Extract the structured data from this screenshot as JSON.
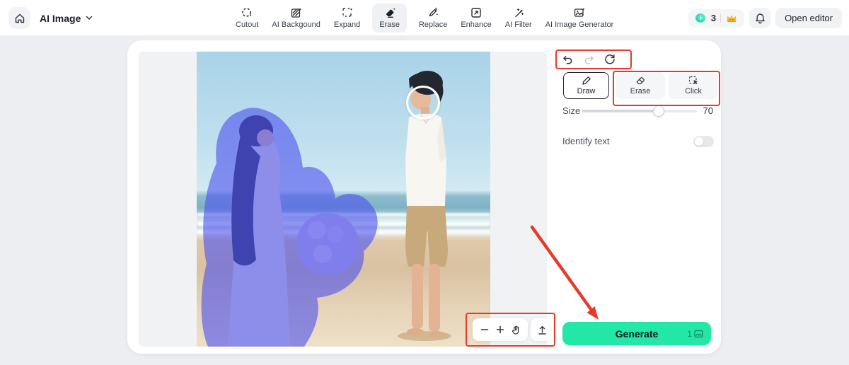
{
  "topbar": {
    "brand_label": "AI Image",
    "tools": [
      {
        "label": "Cutout",
        "icon": "cutout-icon",
        "selected": false
      },
      {
        "label": "AI Backgound",
        "icon": "ai-background-icon",
        "selected": false
      },
      {
        "label": "Expand",
        "icon": "expand-icon",
        "selected": false
      },
      {
        "label": "Erase",
        "icon": "erase-icon",
        "selected": true
      },
      {
        "label": "Replace",
        "icon": "replace-icon",
        "selected": false
      },
      {
        "label": "Enhance",
        "icon": "enhance-icon",
        "selected": false
      },
      {
        "label": "AI Filter",
        "icon": "ai-filter-icon",
        "selected": false
      },
      {
        "label": "AI Image Generator",
        "icon": "ai-image-generator-icon",
        "selected": false
      }
    ],
    "credits": {
      "count": "3",
      "coin_icon": "coin-icon",
      "crown_icon": "crown-icon"
    },
    "bell_icon": "bell-icon",
    "open_editor_label": "Open editor"
  },
  "panel": {
    "history": {
      "undo_icon": "undo-icon",
      "redo_icon": "redo-icon",
      "reset_icon": "reset-icon"
    },
    "modes": [
      {
        "label": "Draw",
        "icon": "brush-icon",
        "selected": true
      },
      {
        "label": "Erase",
        "icon": "eraser-icon",
        "selected": false
      },
      {
        "label": "Click",
        "icon": "click-select-icon",
        "selected": false
      }
    ],
    "size_label": "Size",
    "size_value": "70",
    "identify_text_label": "Identify text",
    "identify_text_on": false,
    "generate_label": "Generate",
    "generate_cost": "1"
  },
  "canvas_controls": {
    "zoom_out_icon": "zoom-out-icon",
    "zoom_in_icon": "zoom-in-icon",
    "pan_icon": "pan-hand-icon",
    "upload_icon": "upload-icon"
  },
  "colors": {
    "generate_green": "#22e7a6",
    "mask_blue": "#4b50ef",
    "annotation_red": "#e8392b",
    "selected_tab_bg": "#f0f1f4"
  }
}
